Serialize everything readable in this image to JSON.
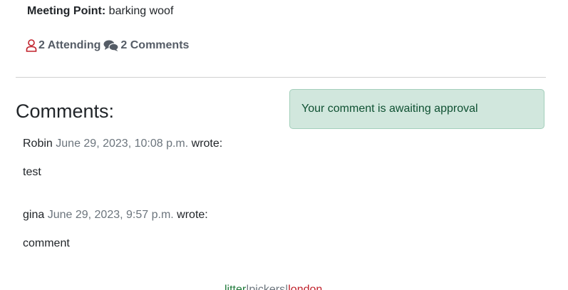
{
  "event": {
    "meeting_point_label": "Meeting Point:",
    "meeting_point_value": "barking woof",
    "attending_text": "2 Attending",
    "comments_text": "2 Comments"
  },
  "alert": {
    "message": "Your comment is awaiting approval"
  },
  "comments_section": {
    "title": "Comments:",
    "items": [
      {
        "author": "Robin",
        "date": "June 29, 2023, 10:08 p.m.",
        "wrote": "wrote:",
        "body": "test"
      },
      {
        "author": "gina",
        "date": "June 29, 2023, 9:57 p.m.",
        "wrote": "wrote:",
        "body": "comment"
      }
    ]
  },
  "footer": {
    "brand_part1": "litter",
    "separator1": "|",
    "brand_part2": "pickers",
    "separator2": "|",
    "brand_part3": "london"
  },
  "icons": {
    "attending": "user-icon",
    "comments": "comments-icon"
  },
  "colors": {
    "attending_icon": "#c0202a",
    "alert_bg": "#d1e7dd",
    "alert_text": "#0f5132",
    "footer_green": "#1f7a3a",
    "footer_red": "#c0202a"
  }
}
